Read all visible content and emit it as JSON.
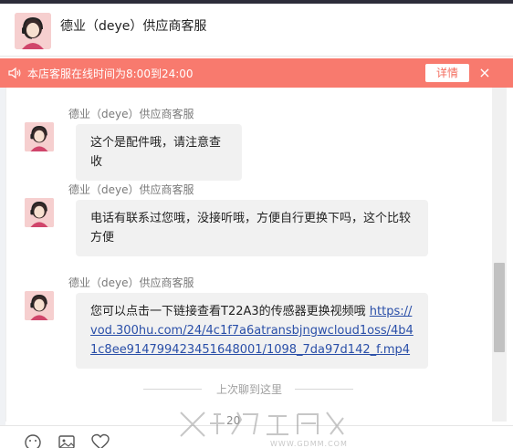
{
  "header": {
    "title": "德业（deye）供应商客服"
  },
  "notice": {
    "text": "本店客服在线时间为8:00到24:00",
    "detail_label": "详情",
    "close_glyph": "×"
  },
  "messages": [
    {
      "sender": "德业（deye）供应商客服",
      "text": "这个是配件哦，请注意查收"
    },
    {
      "sender": "德业（deye）供应商客服",
      "text": "电话有联系过您哦，没接听哦，方便自行更换下吗，这个比较方便"
    },
    {
      "sender": "德业（deye）供应商客服",
      "text": "您可以点击一下链接查看T22A3的传感器更换视频哦 ",
      "link": "https://vod.300hu.com/24/4c1f7a6atransbjngwcloud1oss/4b41c8ee914799423451648001/1098_7da97d142_f.mp4"
    }
  ],
  "divider": {
    "text": "上次聊到这里"
  },
  "partial_stamp": "20",
  "watermark": {
    "url": "WWW.GDMM.COM"
  },
  "colors": {
    "notice_bg": "#f87a6e",
    "bubble_bg": "#f1f1f1",
    "link": "#2a4fa8"
  },
  "toolbar": {
    "icons": [
      "emoji-icon",
      "image-icon",
      "heart-icon"
    ]
  }
}
